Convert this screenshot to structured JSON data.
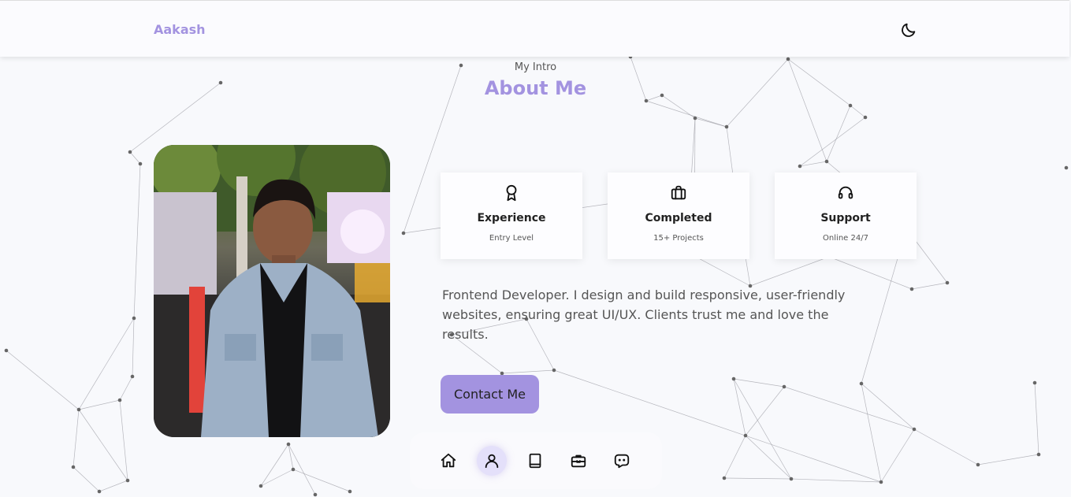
{
  "header": {
    "logo_text": "Aakash",
    "theme_icon": "moon-icon"
  },
  "about": {
    "subtitle": "My Intro",
    "title": "About Me",
    "photo_icon": "profile-photo",
    "cards": [
      {
        "icon": "award-icon",
        "title": "Experience",
        "subtitle": "Entry Level"
      },
      {
        "icon": "briefcase-icon",
        "title": "Completed",
        "subtitle": "15+ Projects"
      },
      {
        "icon": "headset-icon",
        "title": "Support",
        "subtitle": "Online 24/7"
      }
    ],
    "description": "Frontend Developer. I design and build responsive, user-friendly websites, ensuring great UI/UX. Clients trust me and love the results.",
    "contact_label": "Contact Me"
  },
  "bottom_nav": {
    "items": [
      {
        "icon": "home-icon",
        "active": false
      },
      {
        "icon": "user-icon",
        "active": true
      },
      {
        "icon": "book-icon",
        "active": false
      },
      {
        "icon": "briefcase-icon",
        "active": false
      },
      {
        "icon": "chat-icon",
        "active": false
      }
    ]
  },
  "colors": {
    "accent": "#a393e0",
    "background": "#f8f9fc",
    "header_bg": "#fbfbfe",
    "active_nav_bg": "#e4e0fa"
  }
}
